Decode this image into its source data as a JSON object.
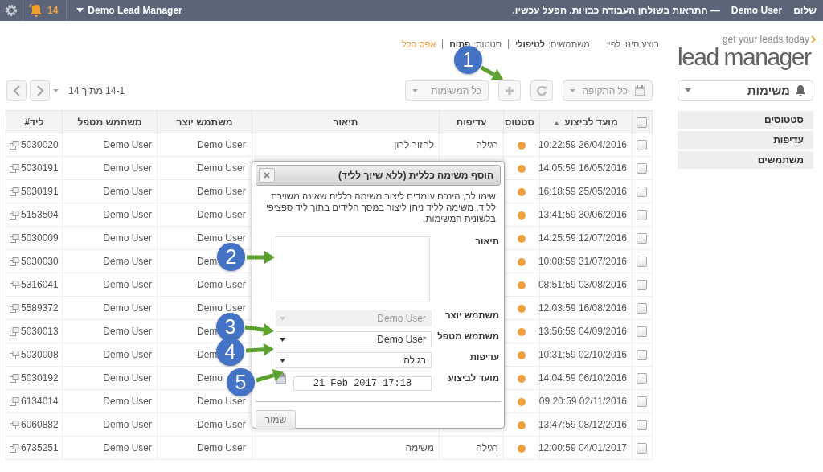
{
  "top_bar": {
    "greeting": "שלום",
    "user": "Demo User",
    "notice": "— התראות בשולחן העבודה כבויות. הפעל עכשיו.",
    "notification_count": "14",
    "app_menu": "Demo Lead Manager"
  },
  "logo": {
    "tagline": "get your leads today",
    "name": "lead manager"
  },
  "filter_summary": {
    "intro": "בוצע סינון לפי:",
    "filters": [
      {
        "label": "משתמשים:",
        "value": "לטיפולי"
      },
      {
        "label": "סטטוס:",
        "value": "פתוח"
      }
    ],
    "reset": "אפס הכל"
  },
  "sidebar": {
    "module_select": "משימות",
    "items": [
      {
        "label": "סטטוסים"
      },
      {
        "label": "עדיפות"
      },
      {
        "label": "משתמשים"
      }
    ]
  },
  "toolbar": {
    "period_select": "כל התקופה",
    "tasks_select": "כל המשימות",
    "pager": "14-1 מתוך 14"
  },
  "table": {
    "select_all_checked": false,
    "columns": [
      {
        "label": "מועד לביצוע",
        "sorted": true
      },
      {
        "label": "סטטוס",
        "sorted": false
      },
      {
        "label": "עדיפות",
        "sorted": false
      },
      {
        "label": "תיאור",
        "sorted": false
      },
      {
        "label": "משתמש יוצר",
        "sorted": false
      },
      {
        "label": "משתמש מטפל",
        "sorted": false
      },
      {
        "label": "ליד#",
        "sorted": false
      }
    ],
    "rows": [
      {
        "checked": false,
        "due": "26/04/2016 10:22:59",
        "priority": "רגילה",
        "description": "לחזור לרון",
        "creator": "Demo User",
        "handler": "Demo User",
        "lead": "5030020"
      },
      {
        "checked": false,
        "due": "16/05/2016 14:05:59",
        "creator": "Demo User",
        "handler": "Demo User",
        "lead": "5030191"
      },
      {
        "checked": false,
        "due": "25/05/2016 16:18:59",
        "creator": "Demo User",
        "handler": "Demo User",
        "lead": "5030191"
      },
      {
        "checked": false,
        "due": "30/06/2016 13:41:59",
        "creator": "Demo User",
        "handler": "Demo User",
        "lead": "5153504"
      },
      {
        "checked": false,
        "due": "12/07/2016 14:25:59",
        "creator": "Demo User",
        "handler": "Demo User",
        "lead": "5030009"
      },
      {
        "checked": false,
        "due": "31/07/2016 10:08:59",
        "creator": "Dem",
        "handler": "Demo User",
        "lead": "5030030"
      },
      {
        "checked": false,
        "due": "03/08/2016 08:51:59",
        "creator": "Demo User",
        "handler": "Demo User",
        "lead": "5316041"
      },
      {
        "checked": false,
        "due": "16/08/2016 12:03:59",
        "creator": "Demo User",
        "handler": "Demo User",
        "lead": "5589372"
      },
      {
        "checked": false,
        "due": "04/09/2016 13:56:59",
        "creator": "Dem",
        "handler": "Demo User",
        "lead": "5030013"
      },
      {
        "checked": false,
        "due": "02/10/2016 10:31:59",
        "creator": "Dem",
        "handler": "Demo User",
        "lead": "5030008"
      },
      {
        "checked": false,
        "due": "06/10/2016 14:04:59",
        "creator": "Demo",
        "handler": "Demo User",
        "lead": "5030192"
      },
      {
        "checked": false,
        "due": "02/11/2016 09:20:59",
        "creator": "Demo User",
        "handler": "Demo User",
        "lead": "6134014"
      },
      {
        "checked": false,
        "due": "08/12/2016 13:47:59",
        "creator": "Demo User",
        "handler": "Demo User",
        "lead": "6060882"
      },
      {
        "checked": false,
        "due": "04/01/2017 12:00:59",
        "priority": "רגילה",
        "description": "משימה",
        "creator": "Demo User",
        "handler": "Demo User",
        "lead": "6735251"
      }
    ]
  },
  "dialog": {
    "title": "הוסף משימה כללית (ללא שיוך לליד)",
    "note": "שימו לב, הינכם עומדים ליצור משימה כללית שאינה משויכת לליד, משימה לליד ניתן ליצור במסך הלידים בתוך ליד ספציפי בלשונית המשימות.",
    "fields": [
      {
        "kind": "textarea",
        "label": "תיאור"
      },
      {
        "kind": "select",
        "label": "משתמש יוצר",
        "value": "Demo User",
        "disabled": true
      },
      {
        "kind": "select",
        "label": "משתמש מטפל",
        "value": "Demo User",
        "disabled": false
      },
      {
        "kind": "select",
        "label": "עדיפות",
        "value": "רגילה",
        "disabled": false
      },
      {
        "kind": "date",
        "label": "מועד לביצוע",
        "value": "21 Feb 2017 17:18"
      }
    ],
    "save_button": "שמור"
  },
  "callouts": [
    {
      "number": "1"
    },
    {
      "number": "2"
    },
    {
      "number": "3"
    },
    {
      "number": "4"
    },
    {
      "number": "5"
    }
  ]
}
